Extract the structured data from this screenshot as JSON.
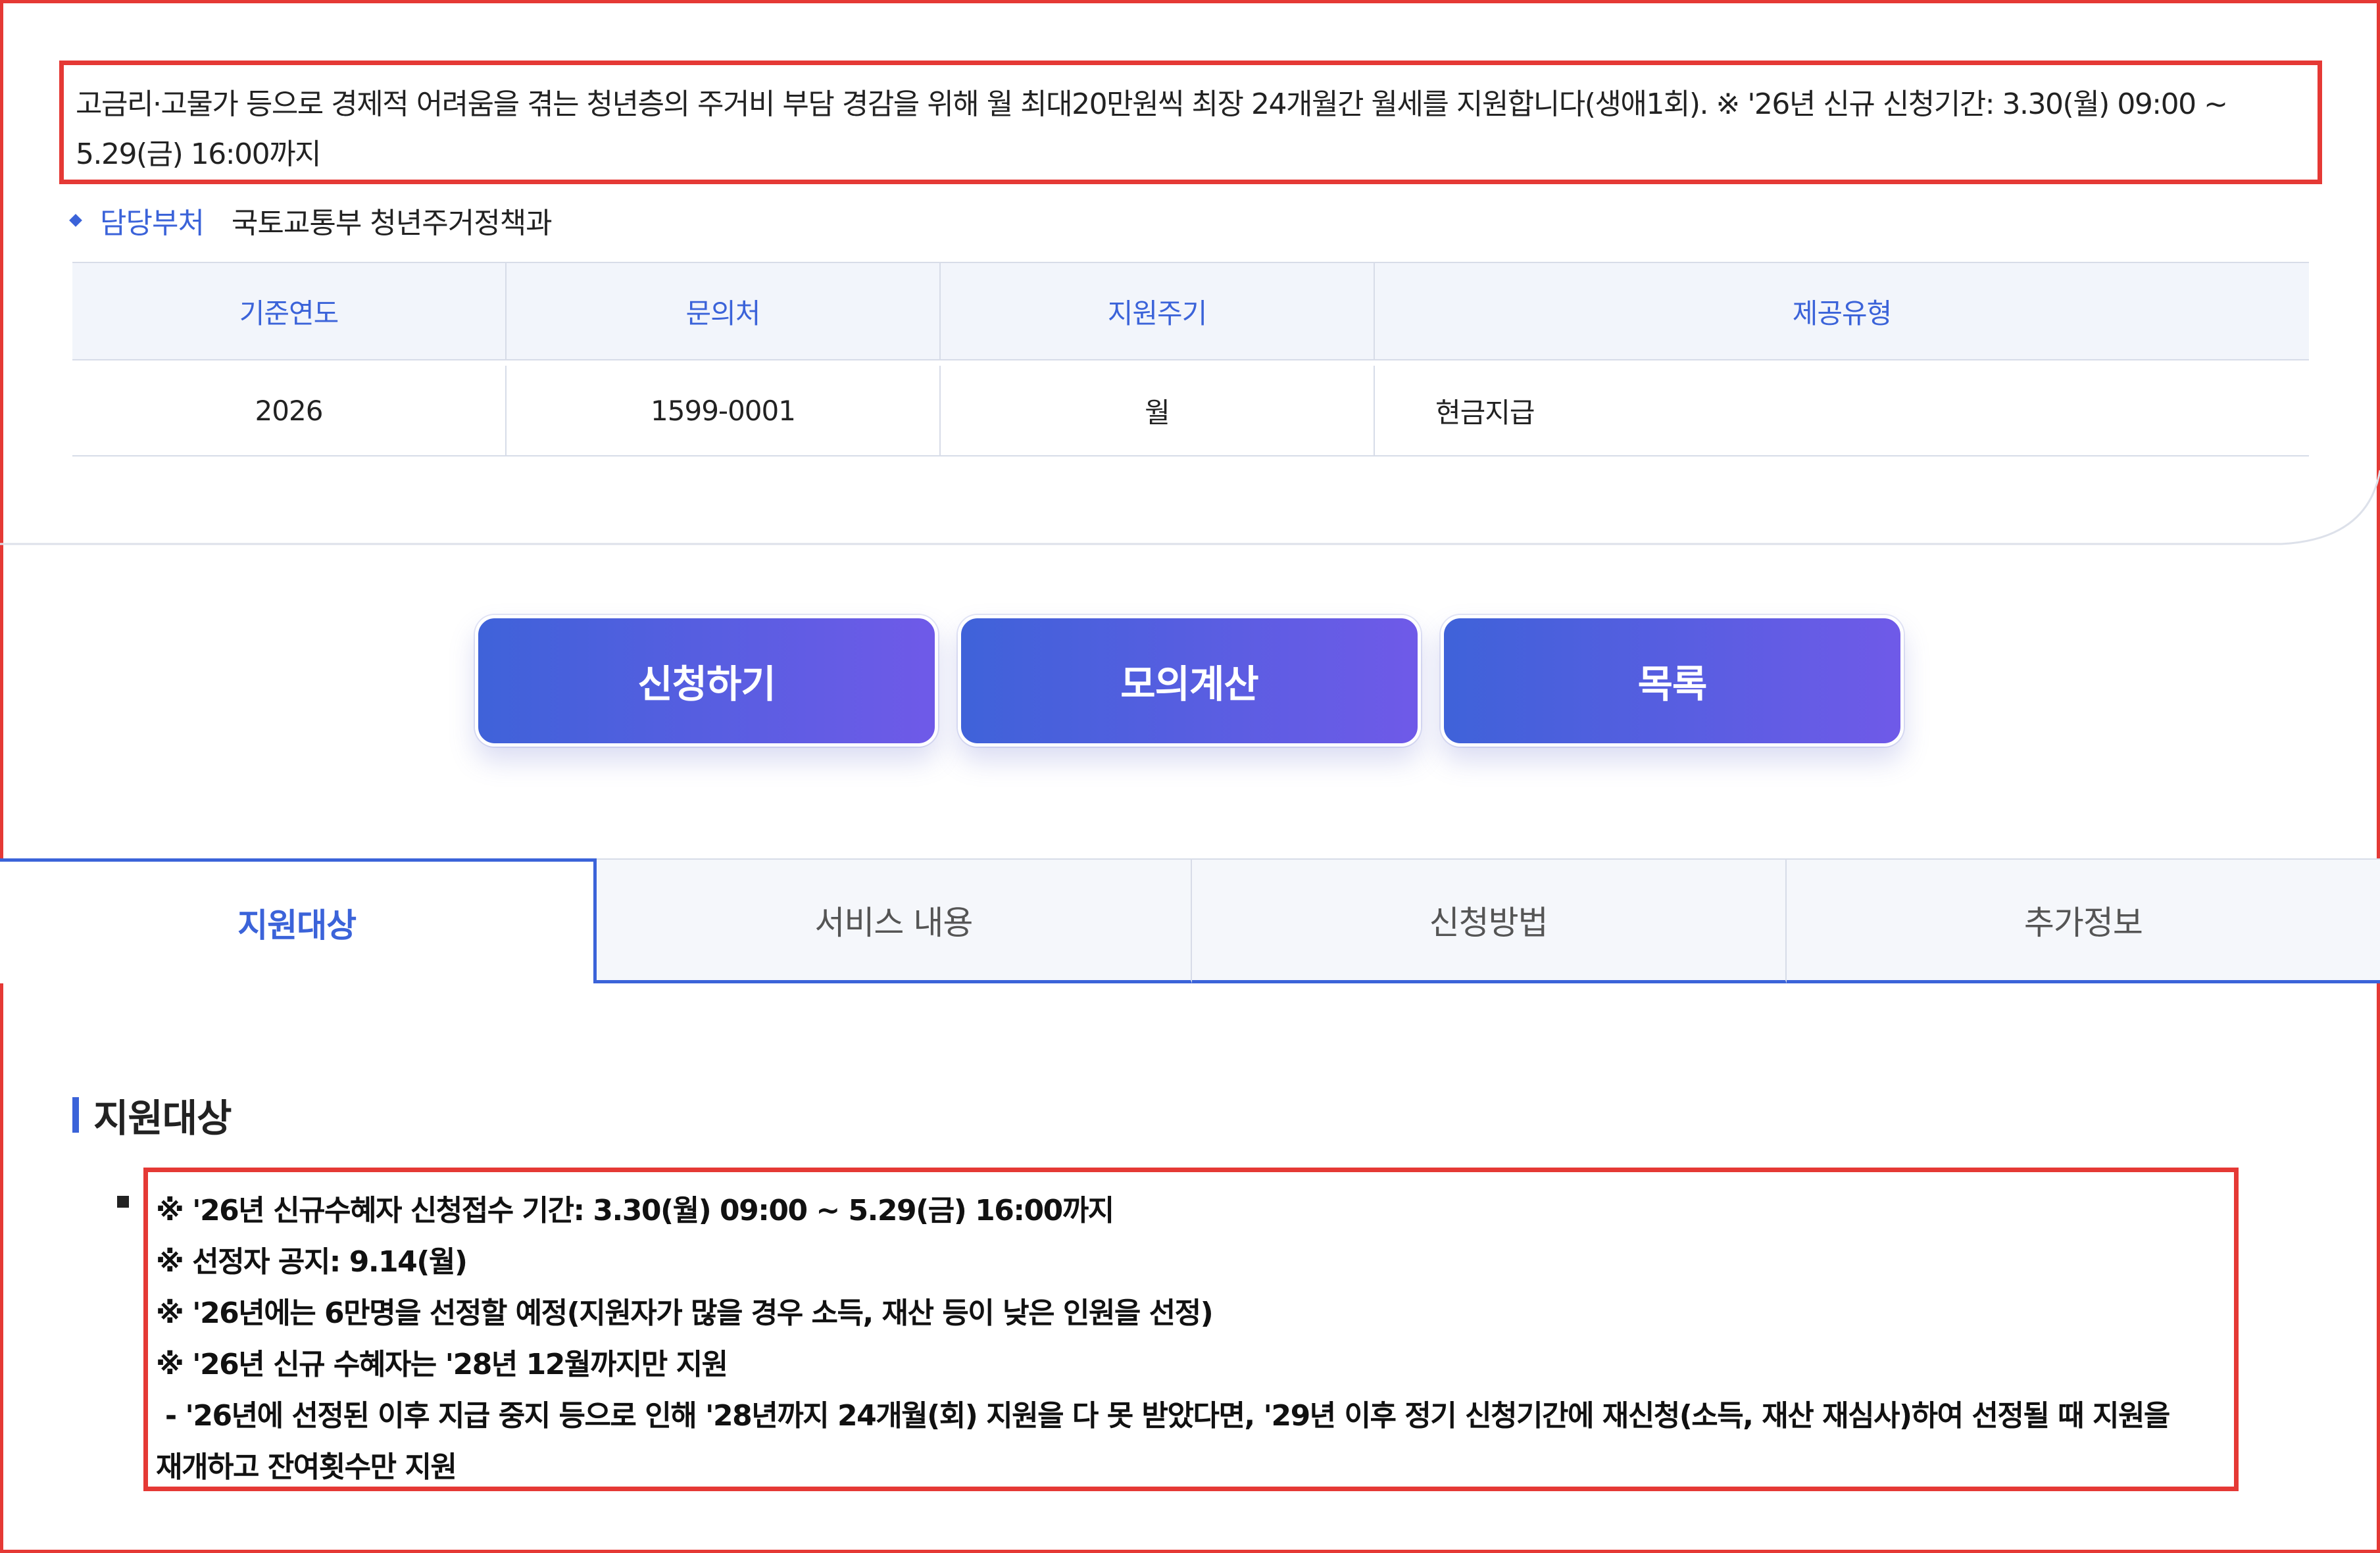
{
  "summary": {
    "line1": "고금리·고물가 등으로 경제적 어려움을 겪는 청년층의 주거비 부담 경감을 위해 월 최대20만원씩 최장 24개월간 월세를 지원합니다(생애1회). ※ '26년 신규 신청기간: 3.30(월) 09:00 ~",
    "line2": "5.29(금) 16:00까지"
  },
  "department": {
    "label": "담당부처",
    "value": "국토교통부 청년주거정책과"
  },
  "info_table": {
    "headers": [
      "기준연도",
      "문의처",
      "지원주기",
      "제공유형"
    ],
    "values": [
      "2026",
      "1599-0001",
      "월",
      "현금지급"
    ]
  },
  "actions": {
    "apply": "신청하기",
    "simulate": "모의계산",
    "list": "목록"
  },
  "tabs": [
    "지원대상",
    "서비스 내용",
    "신청방법",
    "추가정보"
  ],
  "active_tab": "지원대상",
  "section": {
    "title": "지원대상",
    "lines": [
      "※ '26년 신규수혜자 신청접수 기간: 3.30(월) 09:00 ~ 5.29(금) 16:00까지",
      "※ 선정자 공지: 9.14(월)",
      "※ '26년에는 6만명을 선정할 예정(지원자가 많을 경우 소득, 재산 등이 낮은 인원을 선정)",
      "※ '26년 신규 수혜자는 '28년 12월까지만 지원",
      " - '26년에 선정된 이후 지급 중지 등으로 인해 '28년까지 24개월(회) 지원을 다 못 받았다면, '29년 이후 정기 신청기간에 재신청(소득, 재산 재심사)하여 선정될 때 지원을",
      "재개하고 잔여횟수만 지원"
    ]
  },
  "colors": {
    "accent": "#3b63d9",
    "highlight_border": "#e53935",
    "button_gradient_start": "#3f62d9",
    "button_gradient_end": "#6f5ae8"
  }
}
